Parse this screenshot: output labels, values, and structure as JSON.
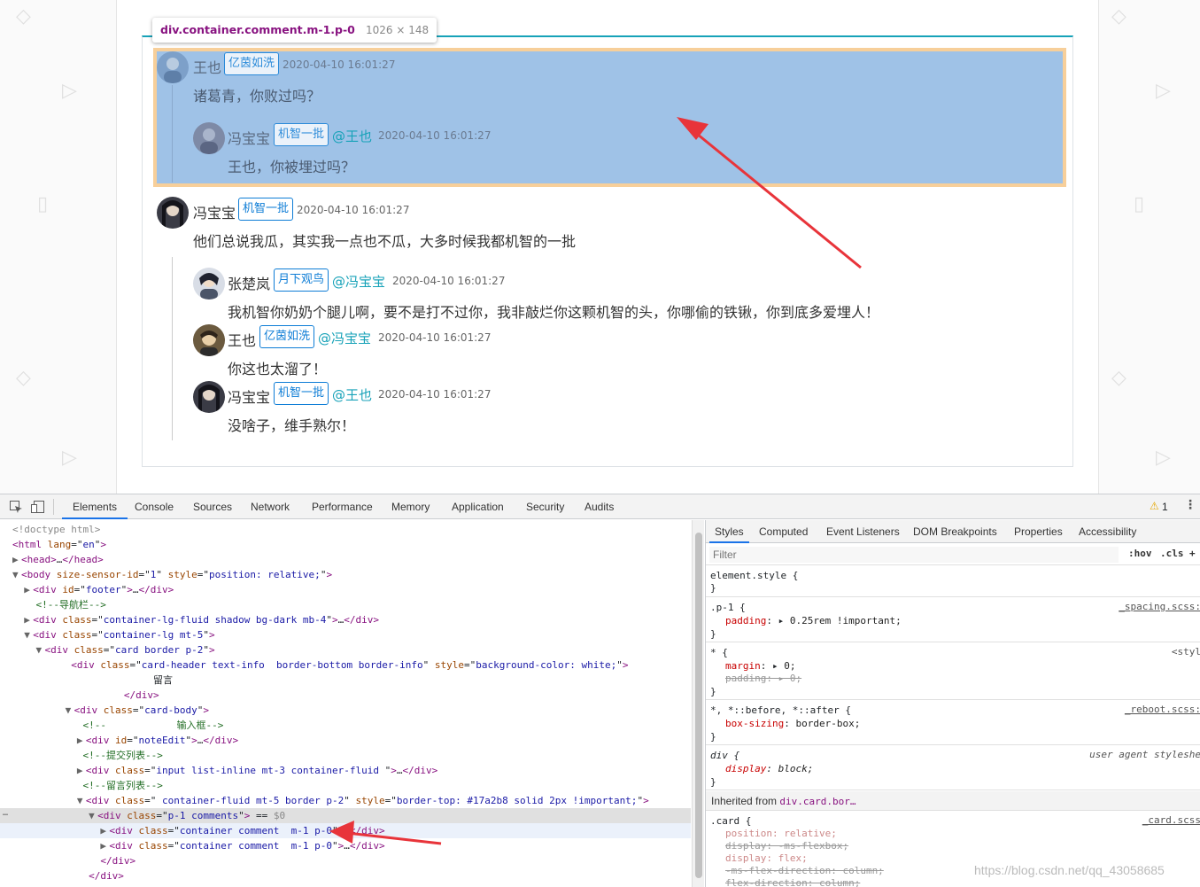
{
  "inspect_tooltip": {
    "selector": "div.container.comment.m-1.p-0",
    "dims": "1026 × 148"
  },
  "comments": [
    {
      "user": "王也",
      "badge": "亿茵如洗",
      "mention": "",
      "time": "2020-04-10 16:01:27",
      "text": "诸葛青，你败过吗？",
      "avatar_color": "#7da0c9",
      "replies": [
        {
          "user": "冯宝宝",
          "badge": "机智一批",
          "mention": "@王也",
          "time": "2020-04-10 16:01:27",
          "text": "王也，你被埋过吗？",
          "avatar_color": "#7e8aa6"
        }
      ]
    },
    {
      "user": "冯宝宝",
      "badge": "机智一批",
      "mention": "",
      "time": "2020-04-10 16:01:27",
      "text": "他们总说我瓜，其实我一点也不瓜，大多时候我都机智的一批",
      "avatar_color": "#3a3b45",
      "replies": [
        {
          "user": "张楚岚",
          "badge": "月下观鸟",
          "mention": "@冯宝宝",
          "time": "2020-04-10 16:01:27",
          "text": "我机智你奶奶个腿儿啊，要不是打不过你，我非敲烂你这颗机智的头，你哪偷的铁锹，你到底多爱埋人！",
          "avatar_color": "#4a5468"
        },
        {
          "user": "王也",
          "badge": "亿茵如洗",
          "mention": "@冯宝宝",
          "time": "2020-04-10 16:01:27",
          "text": "你这也太溜了！",
          "avatar_color": "#6b5a3f"
        },
        {
          "user": "冯宝宝",
          "badge": "机智一批",
          "mention": "@王也",
          "time": "2020-04-10 16:01:27",
          "text": "没啥子，维手熟尔！",
          "avatar_color": "#3a3b45"
        }
      ]
    }
  ],
  "devtools": {
    "tabs": [
      "Elements",
      "Console",
      "Sources",
      "Network",
      "Performance",
      "Memory",
      "Application",
      "Security",
      "Audits"
    ],
    "active_tab": "Elements",
    "warning_count": "1",
    "elements_lines": [
      {
        "html": "<span class='grey'>&lt;!doctype html&gt;</span>"
      },
      {
        "html": "<span class='tag'>&lt;html</span> <span class='attr'>lang</span>=\"<span class='val'>en</span>\"<span class='tag'>&gt;</span>"
      },
      {
        "html": "<span class='tri'>▶</span><span class='tag'>&lt;head&gt;</span>…<span class='tag'>&lt;/head&gt;</span>"
      },
      {
        "html": "<span class='tri'>▼</span><span class='tag'>&lt;body</span> <span class='attr'>size-sensor-id</span>=\"<span class='val'>1</span>\" <span class='attr'>style</span>=\"<span class='val'>position: relative;</span>\"<span class='tag'>&gt;</span>"
      },
      {
        "html": "  <span class='tri'>▶</span><span class='tag'>&lt;div</span> <span class='attr'>id</span>=\"<span class='val'>footer</span>\"<span class='tag'>&gt;</span>…<span class='tag'>&lt;/div&gt;</span>"
      },
      {
        "html": "    <span class='cmt-t'>&lt;!--导航栏--&gt;</span>"
      },
      {
        "html": "  <span class='tri'>▶</span><span class='tag'>&lt;div</span> <span class='attr'>class</span>=\"<span class='val'>container-lg-fluid shadow bg-dark mb-4</span>\"<span class='tag'>&gt;</span>…<span class='tag'>&lt;/div&gt;</span>"
      },
      {
        "html": "  <span class='tri'>▼</span><span class='tag'>&lt;div</span> <span class='attr'>class</span>=\"<span class='val'>container-lg mt-5</span>\"<span class='tag'>&gt;</span>"
      },
      {
        "html": "    <span class='tri'>▼</span><span class='tag'>&lt;div</span> <span class='attr'>class</span>=\"<span class='val'>card border p-2</span>\"<span class='tag'>&gt;</span>"
      },
      {
        "html": "          <span class='tag'>&lt;div</span> <span class='attr'>class</span>=\"<span class='val'>card-header text-info  border-bottom border-info</span>\" <span class='attr'>style</span>=\"<span class='val'>background-color: white;</span>\"<span class='tag'>&gt;</span>"
      },
      {
        "html": "                        留言"
      },
      {
        "html": "                   <span class='tag'>&lt;/div&gt;</span>"
      },
      {
        "html": "         <span class='tri'>▼</span><span class='tag'>&lt;div</span> <span class='attr'>class</span>=\"<span class='val'>card-body</span>\"<span class='tag'>&gt;</span>"
      },
      {
        "html": "            <span class='cmt-t'>&lt;!--            输入框--&gt;</span>"
      },
      {
        "html": "           <span class='tri'>▶</span><span class='tag'>&lt;div</span> <span class='attr'>id</span>=\"<span class='val'>noteEdit</span>\"<span class='tag'>&gt;</span>…<span class='tag'>&lt;/div&gt;</span>"
      },
      {
        "html": "            <span class='cmt-t'>&lt;!--提交列表--&gt;</span>"
      },
      {
        "html": "           <span class='tri'>▶</span><span class='tag'>&lt;div</span> <span class='attr'>class</span>=\"<span class='val'>input list-inline mt-3 container-fluid </span>\"<span class='tag'>&gt;</span>…<span class='tag'>&lt;/div&gt;</span>"
      },
      {
        "html": "            <span class='cmt-t'>&lt;!--留言列表--&gt;</span>"
      },
      {
        "html": "           <span class='tri'>▼</span><span class='tag'>&lt;div</span> <span class='attr'>class</span>=\"<span class='val'> container-fluid mt-5 border p-2</span>\" <span class='attr'>style</span>=\"<span class='val'>border-top: #17a2b8 solid 2px !important;</span>\"<span class='tag'>&gt;</span>"
      },
      {
        "html": "             <span class='tri'>▼</span><span class='tag'>&lt;div</span> <span class='attr'>class</span>=\"<span class='val'>p-1 comments</span>\"<span class='tag'>&gt;</span> == <span class='grey'>$0</span>",
        "cls": "sel"
      },
      {
        "html": "               <span class='tri'>▶</span><span class='tag'>&lt;div</span> <span class='attr'>class</span>=\"<span class='val'>container comment  m-1 p-0</span>\"<span class='tag'>&gt;</span>…<span class='tag'>&lt;/div&gt;</span>",
        "cls": "hov"
      },
      {
        "html": "               <span class='tri'>▶</span><span class='tag'>&lt;div</span> <span class='attr'>class</span>=\"<span class='val'>container comment  m-1 p-0</span>\"<span class='tag'>&gt;</span>…<span class='tag'>&lt;/div&gt;</span>"
      },
      {
        "html": "               <span class='tag'>&lt;/div&gt;</span>"
      },
      {
        "html": "             <span class='tag'>&lt;/div&gt;</span>"
      },
      {
        "html": "           <span class='tag'>&lt;/div&gt;</span>"
      }
    ],
    "styles_tabs": [
      "Styles",
      "Computed",
      "Event Listeners",
      "DOM Breakpoints",
      "Properties",
      "Accessibility"
    ],
    "filter_placeholder": "Filter",
    "hov": ":hov",
    "cls": ".cls",
    "inherited_label": "Inherited from",
    "inherited_from": "div.card.bor…",
    "watermark": "https://blog.csdn.net/qq_43058685"
  }
}
